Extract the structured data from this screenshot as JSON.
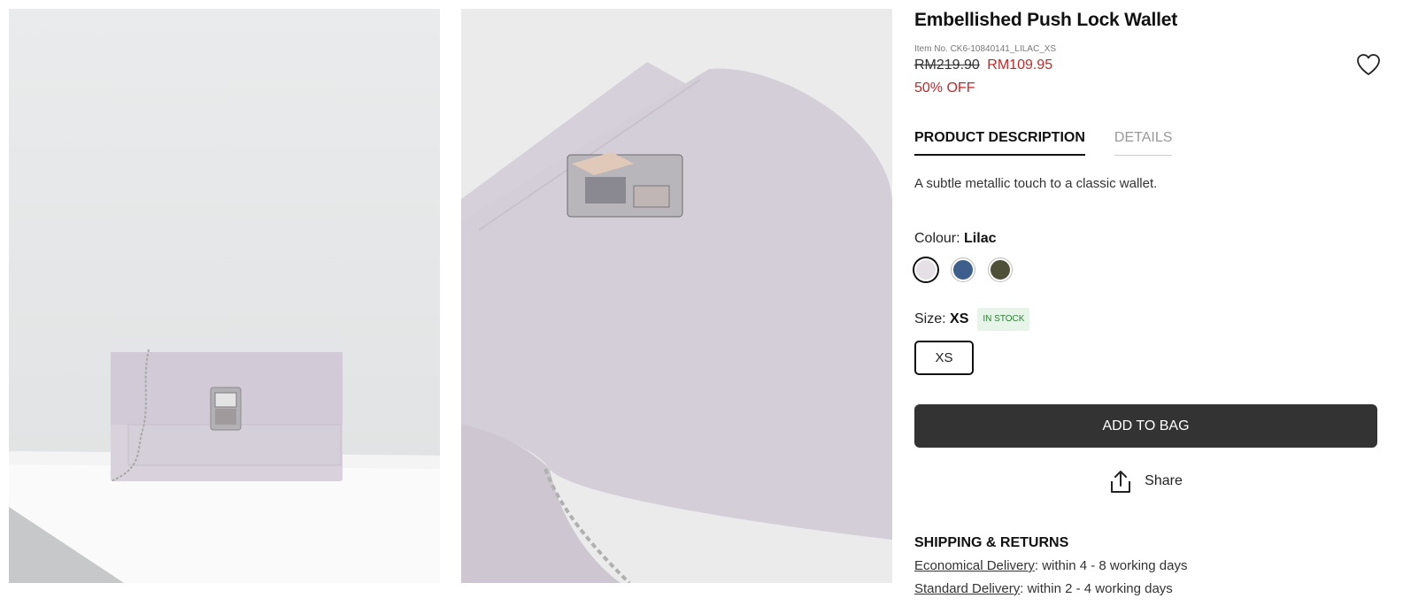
{
  "product": {
    "title": "Embellished Push Lock Wallet",
    "item_no": "Item No. CK6-10840141_LILAC_XS",
    "price_original": "RM219.90",
    "price_sale": "RM109.95",
    "discount": "50% OFF"
  },
  "tabs": [
    {
      "label": "PRODUCT DESCRIPTION",
      "active": true
    },
    {
      "label": "DETAILS",
      "active": false
    }
  ],
  "description": "A subtle metallic touch to a classic wallet.",
  "colour": {
    "label": "Colour:",
    "selected": "Lilac",
    "swatches": [
      {
        "name": "lilac",
        "color": "#e4e0e6"
      },
      {
        "name": "denim-blue",
        "color": "#3e5f8c"
      },
      {
        "name": "olive",
        "color": "#4e5138"
      }
    ]
  },
  "size": {
    "label": "Size:",
    "selected": "XS",
    "stock": "IN STOCK",
    "options": [
      "XS"
    ]
  },
  "actions": {
    "add_to_bag": "ADD TO BAG",
    "share": "Share"
  },
  "shipping": {
    "title": "SHIPPING & RETURNS",
    "lines": [
      {
        "link": "Economical Delivery",
        "text": ": within 4 - 8 working days"
      },
      {
        "link": "Standard Delivery",
        "text": ": within 2 - 4 working days"
      }
    ]
  },
  "icons": {
    "wishlist": "heart-icon",
    "share": "share-icon"
  },
  "colors": {
    "sale": "#c62828",
    "button_bg": "#333333",
    "stock_badge_bg": "#e6f4ea",
    "stock_badge_text": "#2e7d32"
  }
}
